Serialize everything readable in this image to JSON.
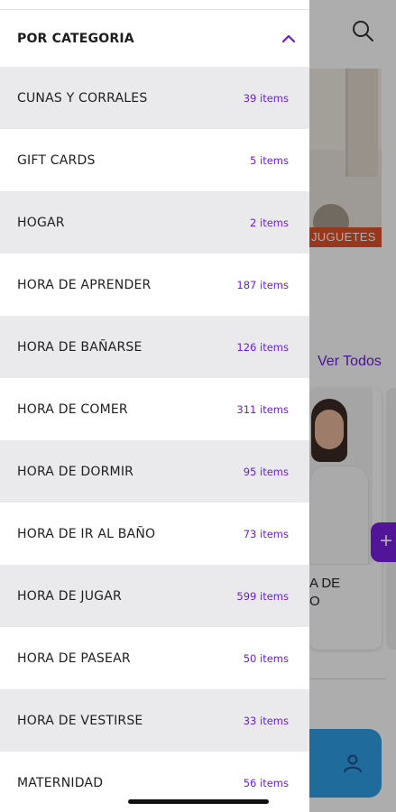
{
  "drawer": {
    "header": {
      "title": "POR CATEGORIA",
      "icon": "chevron-up-icon"
    },
    "categories": [
      {
        "label": "CUNAS Y CORRALES",
        "count": "39 items"
      },
      {
        "label": "GIFT CARDS",
        "count": "5 items"
      },
      {
        "label": "HOGAR",
        "count": "2 items"
      },
      {
        "label": "HORA DE APRENDER",
        "count": "187 items"
      },
      {
        "label": "HORA DE BAÑARSE",
        "count": "126 items"
      },
      {
        "label": "HORA DE COMER",
        "count": "311 items"
      },
      {
        "label": "HORA DE DORMIR",
        "count": "95 items"
      },
      {
        "label": "HORA DE IR AL BAÑO",
        "count": "73 items"
      },
      {
        "label": "HORA DE JUGAR",
        "count": "599 items"
      },
      {
        "label": "HORA DE PASEAR",
        "count": "50 items"
      },
      {
        "label": "HORA DE VESTIRSE",
        "count": "33 items"
      },
      {
        "label": "MATERNIDAD",
        "count": "56 items"
      }
    ]
  },
  "background": {
    "search_icon": "search-icon",
    "banner_label": "JUGUETES",
    "see_all_label": "Ver Todos",
    "product_name_partial": "A DE\nO",
    "add_button_label": "+",
    "fab_icon": "person-icon"
  },
  "colors": {
    "accent": "#6a1fd6",
    "row_alt": "#eaeaec",
    "fab": "#2f9ee6",
    "banner_label_bg": "#e0512a"
  }
}
